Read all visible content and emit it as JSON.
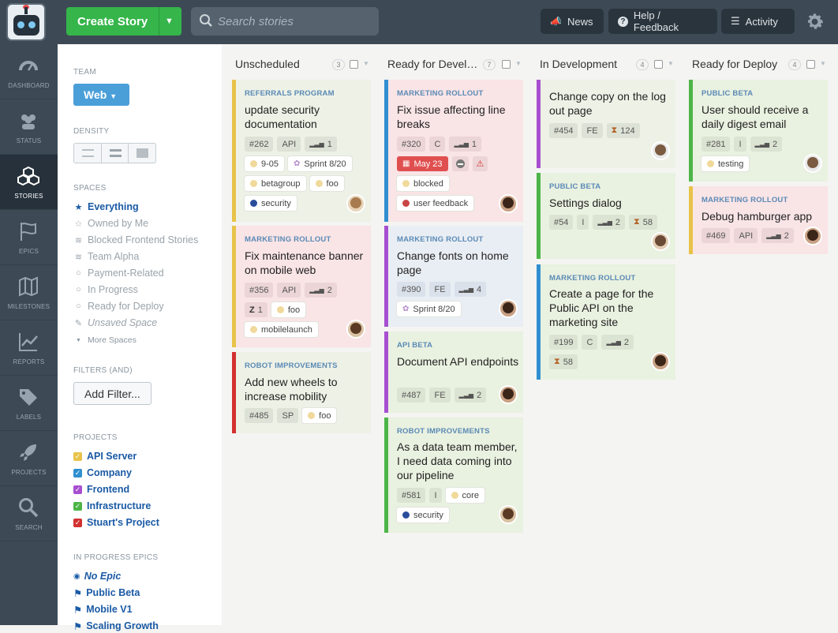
{
  "header": {
    "create_label": "Create Story",
    "search_placeholder": "Search stories",
    "news": "News",
    "help": "Help / Feedback",
    "activity": "Activity"
  },
  "nav": [
    {
      "label": "DASHBOARD",
      "icon": "gauge-icon"
    },
    {
      "label": "STATUS",
      "icon": "people-icon"
    },
    {
      "label": "STORIES",
      "icon": "cubes-icon"
    },
    {
      "label": "EPICS",
      "icon": "flag-icon"
    },
    {
      "label": "MILESTONES",
      "icon": "map-icon"
    },
    {
      "label": "REPORTS",
      "icon": "chart-icon"
    },
    {
      "label": "LABELS",
      "icon": "tag-icon"
    },
    {
      "label": "PROJECTS",
      "icon": "rocket-icon"
    },
    {
      "label": "SEARCH",
      "icon": "search-icon"
    }
  ],
  "panel": {
    "team_header": "TEAM",
    "team": "Web",
    "density_header": "DENSITY",
    "spaces_header": "SPACES",
    "spaces": [
      {
        "label": "Everything",
        "glyph": "★"
      },
      {
        "label": "Owned by Me",
        "glyph": "☆"
      },
      {
        "label": "Blocked Frontend Stories",
        "glyph": "≋"
      },
      {
        "label": "Team Alpha",
        "glyph": "≋"
      },
      {
        "label": "Payment-Related",
        "glyph": "○"
      },
      {
        "label": "In Progress",
        "glyph": "○"
      },
      {
        "label": "Ready for Deploy",
        "glyph": "○"
      },
      {
        "label": "Unsaved Space",
        "glyph": "✎"
      }
    ],
    "more_spaces": "More Spaces",
    "filters_header": "FILTERS (AND)",
    "add_filter": "Add Filter...",
    "projects_header": "PROJECTS",
    "projects": [
      {
        "label": "API Server",
        "color": "#e8c34a"
      },
      {
        "label": "Company",
        "color": "#2f8fd1"
      },
      {
        "label": "Frontend",
        "color": "#a74fd0"
      },
      {
        "label": "Infrastructure",
        "color": "#4db548"
      },
      {
        "label": "Stuart's Project",
        "color": "#d33030"
      }
    ],
    "epics_header": "IN PROGRESS EPICS",
    "epics": [
      {
        "label": "No Epic",
        "glyph": "👁"
      },
      {
        "label": "Public Beta",
        "glyph": "⚑"
      },
      {
        "label": "Mobile V1",
        "glyph": "⚑"
      },
      {
        "label": "Scaling Growth",
        "glyph": "⚑"
      }
    ]
  },
  "columns": [
    {
      "title": "Unscheduled",
      "count": "3"
    },
    {
      "title": "Ready for Devel…",
      "count": "7"
    },
    {
      "title": "In Development",
      "count": "4"
    },
    {
      "title": "Ready for Deploy",
      "count": "4"
    }
  ],
  "cards": {
    "c1": {
      "epic": "REFERRALS PROGRAM",
      "title": "update security documentation",
      "id": "#262",
      "type": "API",
      "est": "1",
      "date": "9-05",
      "sprint": "Sprint 8/20",
      "l1": "betagroup",
      "l2": "foo",
      "l3": "security"
    },
    "c2": {
      "epic": "MARKETING ROLLOUT",
      "title": "Fix maintenance banner on mobile web",
      "id": "#356",
      "type": "API",
      "est": "2",
      "ext": "1",
      "l1": "foo",
      "l2": "mobilelaunch"
    },
    "c3": {
      "epic": "ROBOT IMPROVEMENTS",
      "title": "Add new wheels to increase mobility",
      "id": "#485",
      "type": "SP",
      "l1": "foo"
    },
    "c4": {
      "epic": "MARKETING ROLLOUT",
      "title": "Fix issue affecting line breaks",
      "id": "#320",
      "type": "C",
      "est": "1",
      "due": "May 23",
      "l1": "blocked",
      "l2": "user feedback"
    },
    "c5": {
      "epic": "MARKETING ROLLOUT",
      "title": "Change fonts on home page",
      "id": "#390",
      "type": "FE",
      "est": "4",
      "sprint": "Sprint 8/20"
    },
    "c6": {
      "epic": "API BETA",
      "title": "Document API endpoints",
      "id": "#487",
      "type": "FE",
      "est": "2"
    },
    "c7": {
      "epic": "ROBOT IMPROVEMENTS",
      "title": "As a data team member, I need data coming into our pipeline",
      "id": "#581",
      "type": "I",
      "l1": "core",
      "l2": "security"
    },
    "c8": {
      "title": "Change copy on the log out page",
      "id": "#454",
      "type": "FE",
      "time": "124"
    },
    "c9": {
      "epic": "PUBLIC BETA",
      "title": "Settings dialog",
      "id": "#54",
      "type": "I",
      "est": "2",
      "time": "58"
    },
    "c10": {
      "epic": "MARKETING ROLLOUT",
      "title": "Create a page for the Public API on the marketing site",
      "id": "#199",
      "type": "C",
      "est": "2",
      "time": "58"
    },
    "c11": {
      "epic": "PUBLIC BETA",
      "title": "User should receive a daily digest email",
      "id": "#281",
      "type": "I",
      "est": "2",
      "l1": "testing"
    },
    "c12": {
      "epic": "MARKETING ROLLOUT",
      "title": "Debug hamburger app",
      "id": "#469",
      "type": "API",
      "est": "2"
    }
  },
  "colors": {
    "topbar": "#3d4a56",
    "create": "#35b54a",
    "team": "#4a9fd9",
    "link": "#1a5aa5"
  }
}
